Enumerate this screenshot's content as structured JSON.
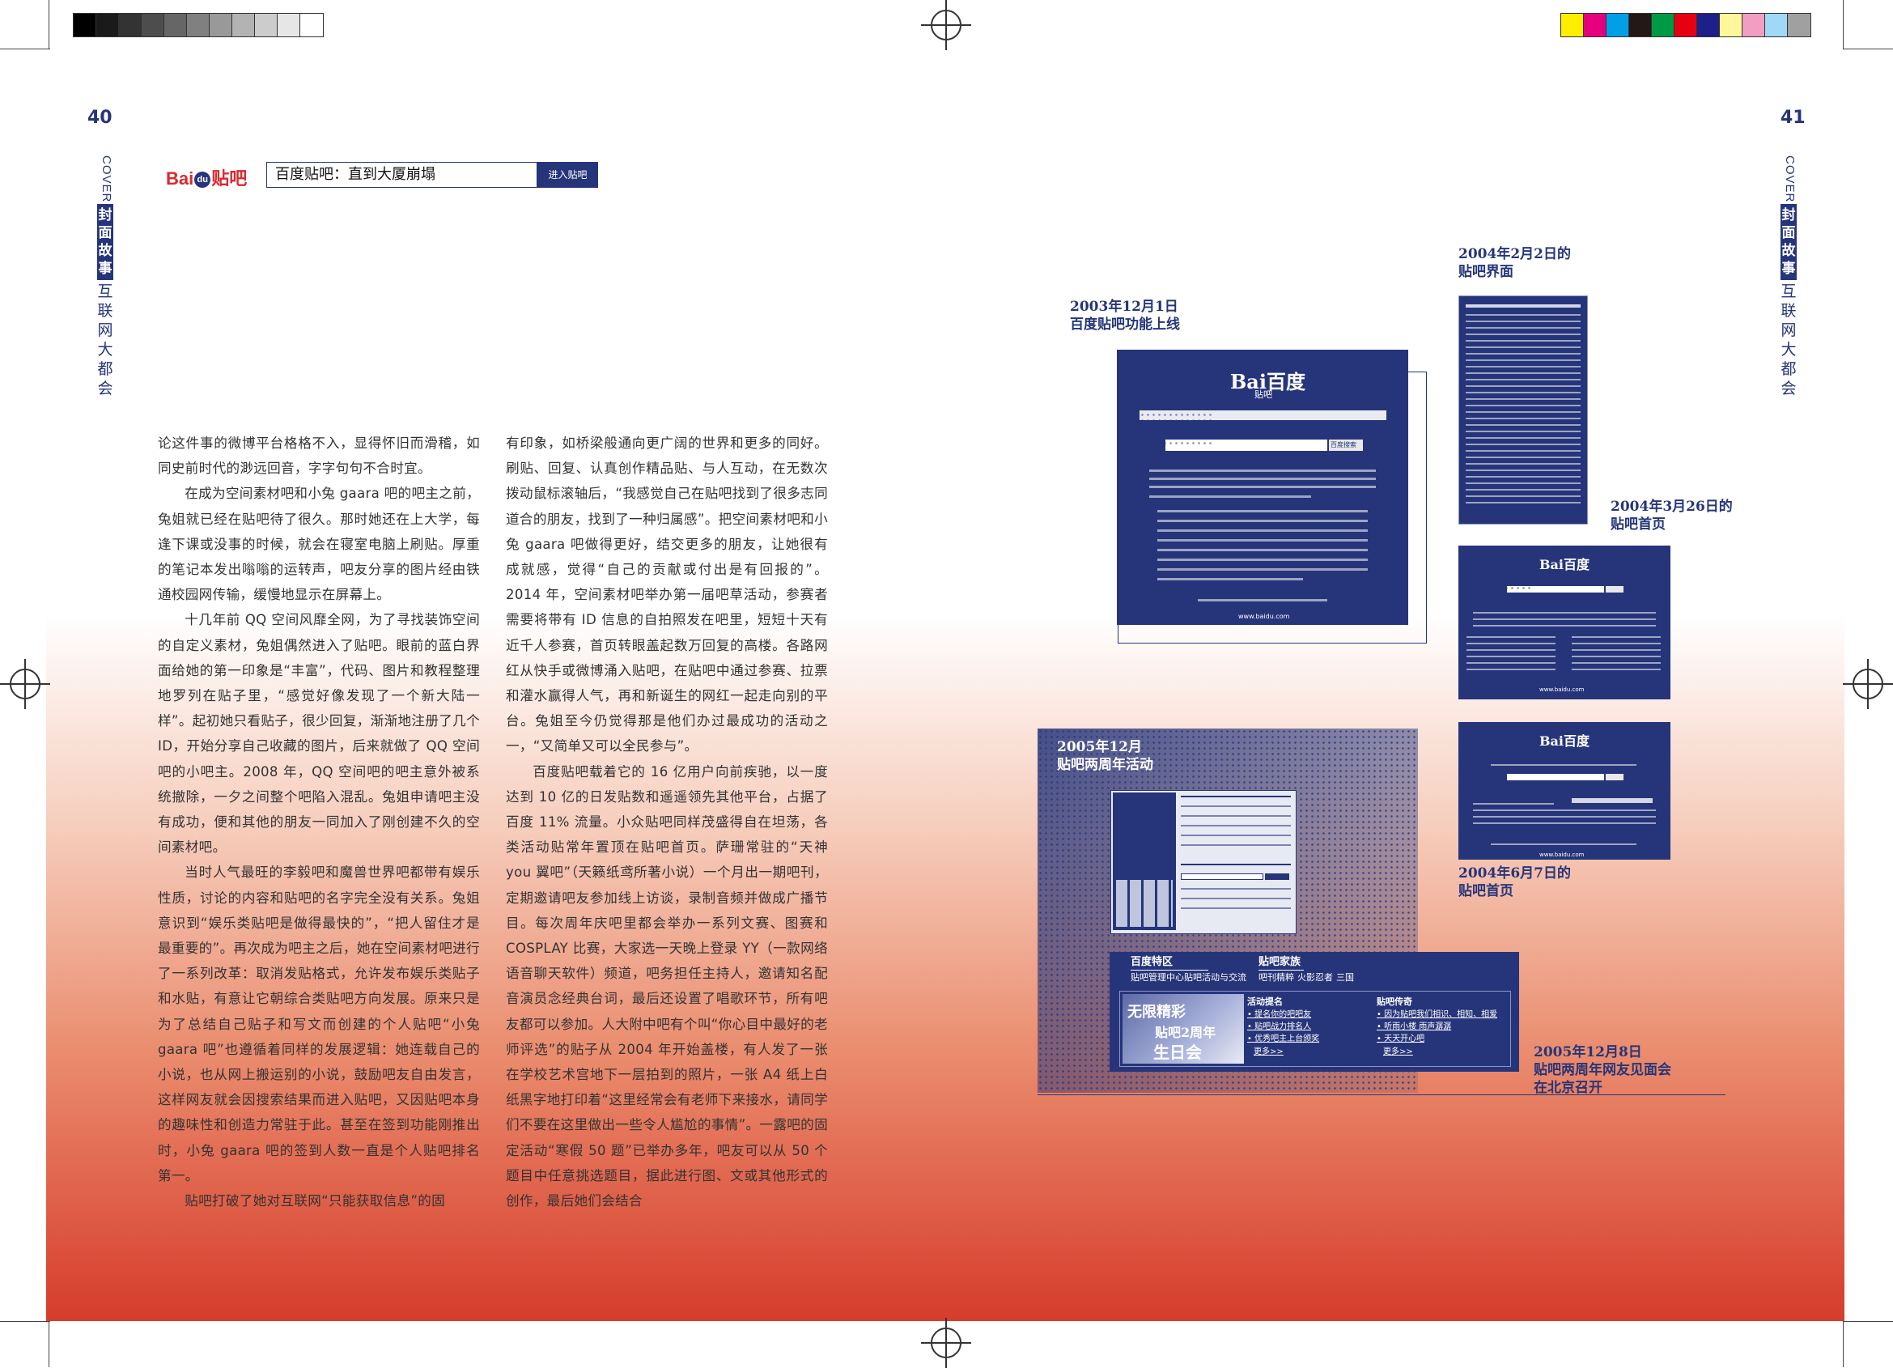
{
  "page": {
    "left_page_number": "40",
    "right_page_number": "41",
    "section_label": "COVER",
    "section_tag": "封面故事",
    "section_title": "互联网大都会"
  },
  "header": {
    "logo_text_bai": "Bai",
    "logo_text_du": "du",
    "logo_text_tieba": "贴吧",
    "title": "百度贴吧：直到大厦崩塌",
    "enter_button": "进入贴吧"
  },
  "colors": {
    "brand_blue": "#26357a",
    "brand_red": "#d72a2f",
    "gradient_red": "#d63c2b"
  },
  "gray_scale": [
    "#000000",
    "#1a1a1a",
    "#333333",
    "#4d4d4d",
    "#666666",
    "#808080",
    "#999999",
    "#b3b3b3",
    "#cccccc",
    "#e6e6e6",
    "#ffffff"
  ],
  "color_bar": [
    "#ffee00",
    "#e6007e",
    "#00a0e9",
    "#231815",
    "#009944",
    "#e60012",
    "#1d2088",
    "#fff799",
    "#f19ec2",
    "#9fd9f6",
    "#a0a0a0"
  ],
  "article": {
    "col1": [
      {
        "indent": false,
        "text": "论这件事的微博平台格格不入，显得怀旧而滑稽，如同史前时代的渺远回音，字字句句不合时宜。"
      },
      {
        "indent": true,
        "text": "在成为空间素材吧和小兔 gaara 吧的吧主之前，兔姐就已经在贴吧待了很久。那时她还在上大学，每逢下课或没事的时候，就会在寝室电脑上刷贴。厚重的笔记本发出嗡嗡的运转声，吧友分享的图片经由铁通校园网传输，缓慢地显示在屏幕上。"
      },
      {
        "indent": true,
        "text": "十几年前 QQ 空间风靡全网，为了寻找装饰空间的自定义素材，兔姐偶然进入了贴吧。眼前的蓝白界面给她的第一印象是“丰富”，代码、图片和教程整理地罗列在贴子里，“感觉好像发现了一个新大陆一样”。起初她只看贴子，很少回复，渐渐地注册了几个 ID，开始分享自己收藏的图片，后来就做了 QQ 空间吧的小吧主。2008 年，QQ 空间吧的吧主意外被系统撤除，一夕之间整个吧陷入混乱。兔姐申请吧主没有成功，便和其他的朋友一同加入了刚创建不久的空间素材吧。"
      },
      {
        "indent": true,
        "text": "当时人气最旺的李毅吧和魔兽世界吧都带有娱乐性质，讨论的内容和贴吧的名字完全没有关系。兔姐意识到“娱乐类贴吧是做得最快的”，“把人留住才是最重要的”。再次成为吧主之后，她在空间素材吧进行了一系列改革：取消发贴格式，允许发布娱乐类贴子和水贴，有意让它朝综合类贴吧方向发展。原来只是为了总结自己贴子和写文而创建的个人贴吧“小兔 gaara 吧”也遵循着同样的发展逻辑：她连载自己的小说，也从网上搬运别的小说，鼓励吧友自由发言，这样网友就会因搜索结果而进入贴吧，又因贴吧本身的趣味性和创造力常驻于此。甚至在签到功能刚推出时，小兔 gaara 吧的签到人数一直是个人贴吧排名第一。"
      },
      {
        "indent": true,
        "text": "贴吧打破了她对互联网“只能获取信息”的固"
      }
    ],
    "col2": [
      {
        "indent": false,
        "text": "有印象，如桥梁般通向更广阔的世界和更多的同好。刷贴、回复、认真创作精品贴、与人互动，在无数次拨动鼠标滚轴后，“我感觉自己在贴吧找到了很多志同道合的朋友，找到了一种归属感”。把空间素材吧和小兔 gaara 吧做得更好，结交更多的朋友，让她很有成就感，觉得“自己的贡献或付出是有回报的”。2014 年，空间素材吧举办第一届吧草活动，参赛者需要将带有 ID 信息的自拍照发在吧里，短短十天有近千人参赛，首页转眼盖起数万回复的高楼。各路网红从快手或微博涌入贴吧，在贴吧中通过参赛、拉票和灌水赢得人气，再和新诞生的网红一起走向别的平台。兔姐至今仍觉得那是他们办过最成功的活动之一，“又简单又可以全民参与”。"
      },
      {
        "indent": true,
        "text": "百度贴吧载着它的 16 亿用户向前疾驰，以一度达到 10 亿的日发贴数和遥遥领先其他平台，占据了百度 11% 流量。小众贴吧同样茂盛得自在坦荡，各类活动贴常年置顶在贴吧首页。萨珊常驻的“天神 you 翼吧”（天籁纸鸢所著小说）一个月出一期吧刊，定期邀请吧友参加线上访谈，录制音频并做成广播节目。每次周年庆吧里都会举办一系列文赛、图赛和 COSPLAY 比赛，大家选一天晚上登录 YY（一款网络语音聊天软件）频道，吧务担任主持人，邀请知名配音演员念经典台词，最后还设置了唱歌环节，所有吧友都可以参加。人大附中吧有个叫“你心目中最好的老师评选”的贴子从 2004 年开始盖楼，有人发了一张在学校艺术宫地下一层拍到的照片，一张 A4 纸上白纸黑字地打印着“这里经常会有老师下来接水，请同学们不要在这里做出一些令人尴尬的事情”。一露吧的固定活动“寒假 50 题”已举办多年，吧友可以从 50 个题目中任意挑选题目，据此进行图、文或其他形式的创作，最后她们会结合"
      }
    ]
  },
  "timeline": {
    "cap_2003": [
      "2003年12月1日",
      "百度贴吧功能上线"
    ],
    "cap_2004_0202": [
      "2004年2月2日的",
      "贴吧界面"
    ],
    "cap_2004_0326": [
      "2004年3月26日的",
      "贴吧首页"
    ],
    "cap_2004_0607": [
      "2004年6月7日的",
      "贴吧首页"
    ],
    "cap_2005_12": [
      "2005年12月",
      "贴吧两周年活动"
    ],
    "cap_2005_1208": [
      "2005年12月8日",
      "贴吧两周年网友见面会",
      "在北京召开"
    ]
  },
  "screens": {
    "baidu_logo": "Bai百度",
    "tieba_label": "贴吧",
    "search_button": "百度搜索",
    "site_url": "www.baidu.com",
    "banner_sections": [
      "百度特区",
      "贴吧家族"
    ],
    "banner_links_1": [
      "贴吧管理中心",
      "贴吧活动与交流"
    ],
    "banner_links_2": [
      "吧刊精粹",
      "火影忍者",
      "三国"
    ],
    "banner_main": [
      "无限精彩",
      "贴吧2周年",
      "生日会"
    ],
    "banner_activity_title": "活动提名",
    "banner_activity_items": [
      "• 提名你的吧吧友",
      "• 贴吧战力排名人",
      "• 优秀吧主上台颁奖"
    ],
    "banner_news_title": "贴吧传奇",
    "banner_news_items": [
      "• 因为贴吧我们相识、相知、相爱",
      "• 听雨小楼 雨声潺潺",
      "• 天天开心吧"
    ],
    "more_link": "更多>>"
  }
}
